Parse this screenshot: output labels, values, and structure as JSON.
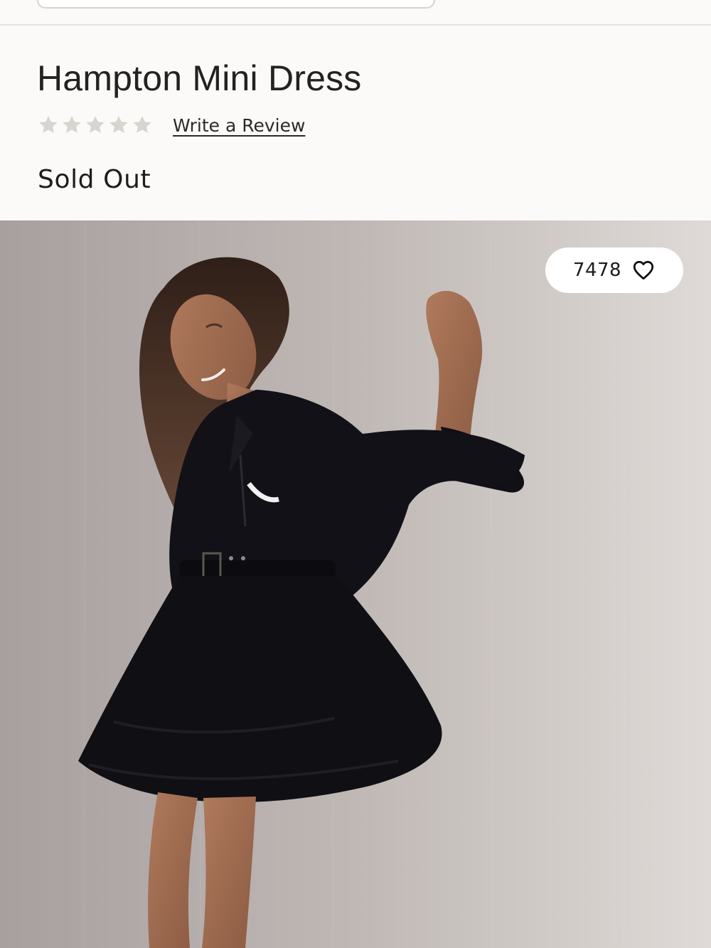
{
  "product": {
    "title": "Hampton Mini Dress",
    "rating": {
      "stars_filled": 0,
      "stars_total": 5,
      "write_review_label": "Write a Review"
    },
    "availability": "Sold Out"
  },
  "hero_image": {
    "alt": "Model wearing black Hampton Mini Dress",
    "wishlist": {
      "count": "7478",
      "icon": "heart-icon"
    }
  },
  "colors": {
    "background": "#fcfaf8",
    "text": "#1f1f1f",
    "star_empty": "#d8d4d0",
    "divider": "#e7e3df"
  }
}
